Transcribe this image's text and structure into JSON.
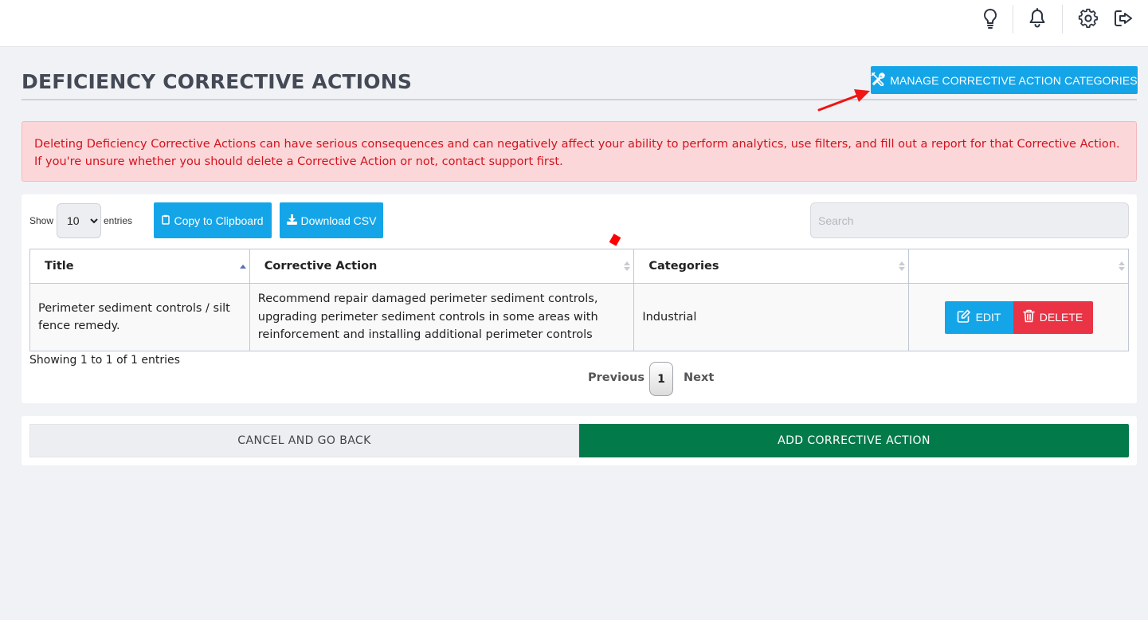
{
  "page": {
    "title": "DEFICIENCY CORRECTIVE ACTIONS",
    "manage_button": "MANAGE CORRECTIVE ACTION CATEGORIES"
  },
  "topbar": {
    "icons": [
      "lightbulb-icon",
      "bell-icon",
      "gear-icon",
      "logout-icon"
    ]
  },
  "alert": {
    "text": "Deleting Deficiency Corrective Actions can have serious consequences and can negatively affect your ability to perform analytics, use filters, and fill out a report for that Corrective Action. If you're unsure whether you should delete a Corrective Action or not, contact support first."
  },
  "table_controls": {
    "show_label": "Show",
    "entries_label": "entries",
    "page_length": "10",
    "copy_button": "Copy to Clipboard",
    "csv_button": "Download CSV",
    "search_placeholder": "Search"
  },
  "table": {
    "columns": [
      "Title",
      "Corrective Action",
      "Categories",
      ""
    ],
    "rows": [
      {
        "title": "Perimeter sediment controls / silt fence remedy.",
        "corrective_action": "Recommend repair damaged perimeter sediment controls, upgrading perimeter sediment controls in some areas with reinforcement and installing additional perimeter controls",
        "categories": "Industrial",
        "edit_label": "EDIT",
        "delete_label": "DELETE"
      }
    ]
  },
  "pagination": {
    "info": "Showing 1 to 1 of 1 entries",
    "previous": "Previous",
    "current_page": "1",
    "next": "Next"
  },
  "footer": {
    "cancel": "CANCEL AND GO BACK",
    "add": "ADD CORRECTIVE ACTION"
  },
  "colors": {
    "primary": "#14a5e8",
    "danger": "#ea3344",
    "success": "#037a4a",
    "alert_bg": "#fbd7d9",
    "alert_text": "#d3131e"
  }
}
